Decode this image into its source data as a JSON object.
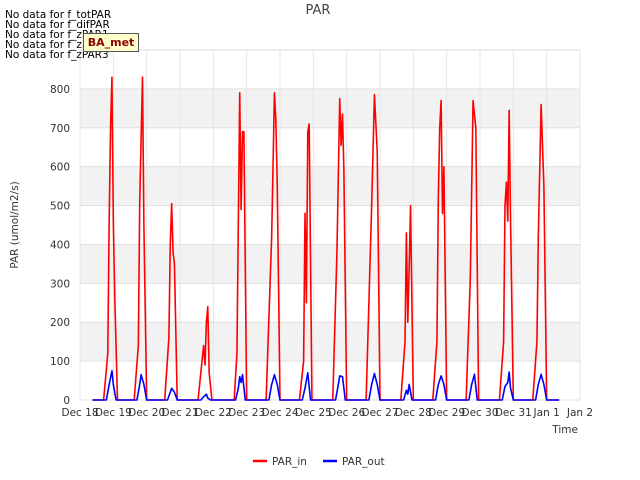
{
  "no_data_notes": [
    "No data for f_totPAR",
    "No data for f_difPAR",
    "No data for f_zPAR1",
    "No data for f_zPAR2",
    "No data for f_zPAR3"
  ],
  "badge": {
    "label": "BA_met",
    "bg": "#ffffcc",
    "text_color": "#8b0000"
  },
  "chart_data": {
    "type": "line",
    "title": "PAR",
    "xlabel": "Time",
    "ylabel": "PAR (umol/m2/s)",
    "ylim": [
      0,
      900
    ],
    "y_ticks": [
      0,
      100,
      200,
      300,
      400,
      500,
      600,
      700,
      800
    ],
    "x_range": [
      "2016-12-18",
      "2017-01-02"
    ],
    "x_tick_labels": [
      "Dec 18",
      "Dec 19",
      "Dec 20",
      "Dec 21",
      "Dec 22",
      "Dec 23",
      "Dec 24",
      "Dec 25",
      "Dec 26",
      "Dec 27",
      "Dec 28",
      "Dec 29",
      "Dec 30",
      "Dec 31",
      "Jan 1",
      "Jan 2"
    ],
    "x_tick_dates": [
      "2016-12-18",
      "2016-12-19",
      "2016-12-20",
      "2016-12-21",
      "2016-12-22",
      "2016-12-23",
      "2016-12-24",
      "2016-12-25",
      "2016-12-26",
      "2016-12-27",
      "2016-12-28",
      "2016-12-29",
      "2016-12-30",
      "2016-12-31",
      "2017-01-01",
      "2017-01-02"
    ],
    "grid": true,
    "legend_placement": "bottom-center",
    "series": [
      {
        "name": "PAR_in",
        "color": "#ff0000",
        "points": [
          [
            "2016-12-18 09:00",
            0
          ],
          [
            "2016-12-18 17:00",
            0
          ],
          [
            "2016-12-18 20:00",
            120
          ],
          [
            "2016-12-18 21:00",
            460
          ],
          [
            "2016-12-18 22:00",
            700
          ],
          [
            "2016-12-18 23:00",
            830
          ],
          [
            "2016-12-19 00:00",
            460
          ],
          [
            "2016-12-19 01:00",
            270
          ],
          [
            "2016-12-19 03:00",
            0
          ],
          [
            "2016-12-19 15:00",
            0
          ],
          [
            "2016-12-19 18:00",
            140
          ],
          [
            "2016-12-19 19:00",
            510
          ],
          [
            "2016-12-19 21:00",
            830
          ],
          [
            "2016-12-19 22:00",
            450
          ],
          [
            "2016-12-20 00:00",
            0
          ],
          [
            "2016-12-20 13:00",
            0
          ],
          [
            "2016-12-20 16:00",
            160
          ],
          [
            "2016-12-20 17:00",
            400
          ],
          [
            "2016-12-20 18:00",
            505
          ],
          [
            "2016-12-20 19:00",
            380
          ],
          [
            "2016-12-20 20:00",
            350
          ],
          [
            "2016-12-20 22:00",
            0
          ],
          [
            "2016-12-21 13:00",
            0
          ],
          [
            "2016-12-21 17:00",
            140
          ],
          [
            "2016-12-21 18:00",
            90
          ],
          [
            "2016-12-21 19:00",
            200
          ],
          [
            "2016-12-21 20:00",
            240
          ],
          [
            "2016-12-21 21:00",
            70
          ],
          [
            "2016-12-21 23:00",
            0
          ],
          [
            "2016-12-22 15:00",
            0
          ],
          [
            "2016-12-22 17:00",
            120
          ],
          [
            "2016-12-22 19:00",
            790
          ],
          [
            "2016-12-22 20:00",
            490
          ],
          [
            "2016-12-22 21:00",
            690
          ],
          [
            "2016-12-22 22:00",
            690
          ],
          [
            "2016-12-23 00:00",
            0
          ],
          [
            "2016-12-23 14:00",
            0
          ],
          [
            "2016-12-23 18:00",
            420
          ],
          [
            "2016-12-23 20:00",
            790
          ],
          [
            "2016-12-23 21:00",
            720
          ],
          [
            "2016-12-23 22:00",
            560
          ],
          [
            "2016-12-24 00:00",
            0
          ],
          [
            "2016-12-24 14:00",
            0
          ],
          [
            "2016-12-24 17:00",
            100
          ],
          [
            "2016-12-24 18:00",
            480
          ],
          [
            "2016-12-24 19:00",
            250
          ],
          [
            "2016-12-24 20:00",
            690
          ],
          [
            "2016-12-24 21:00",
            710
          ],
          [
            "2016-12-24 23:00",
            0
          ],
          [
            "2016-12-25 14:00",
            0
          ],
          [
            "2016-12-25 17:00",
            380
          ],
          [
            "2016-12-25 19:00",
            775
          ],
          [
            "2016-12-25 20:00",
            655
          ],
          [
            "2016-12-25 21:00",
            735
          ],
          [
            "2016-12-25 22:00",
            590
          ],
          [
            "2016-12-26 00:00",
            0
          ],
          [
            "2016-12-26 14:00",
            0
          ],
          [
            "2016-12-26 18:00",
            500
          ],
          [
            "2016-12-26 20:00",
            785
          ],
          [
            "2016-12-26 22:00",
            640
          ],
          [
            "2016-12-27 00:00",
            0
          ],
          [
            "2016-12-27 15:00",
            0
          ],
          [
            "2016-12-27 18:00",
            150
          ],
          [
            "2016-12-27 19:00",
            430
          ],
          [
            "2016-12-27 20:00",
            200
          ],
          [
            "2016-12-27 21:00",
            340
          ],
          [
            "2016-12-27 22:00",
            500
          ],
          [
            "2016-12-28 00:00",
            0
          ],
          [
            "2016-12-28 14:00",
            0
          ],
          [
            "2016-12-28 17:00",
            150
          ],
          [
            "2016-12-28 18:00",
            520
          ],
          [
            "2016-12-28 19:00",
            700
          ],
          [
            "2016-12-28 20:00",
            770
          ],
          [
            "2016-12-28 21:00",
            480
          ],
          [
            "2016-12-28 22:00",
            600
          ],
          [
            "2016-12-29 00:00",
            0
          ],
          [
            "2016-12-29 14:00",
            0
          ],
          [
            "2016-12-29 17:00",
            310
          ],
          [
            "2016-12-29 19:00",
            770
          ],
          [
            "2016-12-29 21:00",
            700
          ],
          [
            "2016-12-29 23:00",
            0
          ],
          [
            "2016-12-30 14:00",
            0
          ],
          [
            "2016-12-30 17:00",
            150
          ],
          [
            "2016-12-30 18:00",
            500
          ],
          [
            "2016-12-30 19:00",
            560
          ],
          [
            "2016-12-30 20:00",
            460
          ],
          [
            "2016-12-30 21:00",
            745
          ],
          [
            "2016-12-30 22:00",
            460
          ],
          [
            "2016-12-31 00:00",
            0
          ],
          [
            "2016-12-31 14:00",
            0
          ],
          [
            "2016-12-31 17:00",
            150
          ],
          [
            "2016-12-31 18:00",
            420
          ],
          [
            "2016-12-31 20:00",
            760
          ],
          [
            "2016-12-31 22:00",
            550
          ],
          [
            "2017-01-01 00:00",
            0
          ],
          [
            "2017-01-01 09:00",
            0
          ]
        ]
      },
      {
        "name": "PAR_out",
        "color": "#0000ff",
        "points": [
          [
            "2016-12-18 09:00",
            0
          ],
          [
            "2016-12-18 19:00",
            0
          ],
          [
            "2016-12-18 21:00",
            40
          ],
          [
            "2016-12-18 23:00",
            75
          ],
          [
            "2016-12-19 00:00",
            40
          ],
          [
            "2016-12-19 02:00",
            0
          ],
          [
            "2016-12-19 17:00",
            0
          ],
          [
            "2016-12-19 19:00",
            40
          ],
          [
            "2016-12-19 20:00",
            65
          ],
          [
            "2016-12-19 22:00",
            40
          ],
          [
            "2016-12-20 00:00",
            0
          ],
          [
            "2016-12-20 15:00",
            0
          ],
          [
            "2016-12-20 17:00",
            20
          ],
          [
            "2016-12-20 18:00",
            30
          ],
          [
            "2016-12-20 20:00",
            20
          ],
          [
            "2016-12-20 22:00",
            0
          ],
          [
            "2016-12-21 15:00",
            0
          ],
          [
            "2016-12-21 17:00",
            8
          ],
          [
            "2016-12-21 19:00",
            15
          ],
          [
            "2016-12-21 20:00",
            5
          ],
          [
            "2016-12-21 22:00",
            0
          ],
          [
            "2016-12-22 16:00",
            0
          ],
          [
            "2016-12-22 18:00",
            30
          ],
          [
            "2016-12-22 19:00",
            60
          ],
          [
            "2016-12-22 20:00",
            45
          ],
          [
            "2016-12-22 21:00",
            65
          ],
          [
            "2016-12-22 23:00",
            0
          ],
          [
            "2016-12-23 16:00",
            0
          ],
          [
            "2016-12-23 18:00",
            40
          ],
          [
            "2016-12-23 20:00",
            65
          ],
          [
            "2016-12-23 22:00",
            40
          ],
          [
            "2016-12-24 00:00",
            0
          ],
          [
            "2016-12-24 16:00",
            0
          ],
          [
            "2016-12-24 18:00",
            30
          ],
          [
            "2016-12-24 20:00",
            70
          ],
          [
            "2016-12-24 22:00",
            0
          ],
          [
            "2016-12-25 16:00",
            0
          ],
          [
            "2016-12-25 18:00",
            40
          ],
          [
            "2016-12-25 19:00",
            62
          ],
          [
            "2016-12-25 21:00",
            60
          ],
          [
            "2016-12-25 23:00",
            0
          ],
          [
            "2016-12-26 16:00",
            0
          ],
          [
            "2016-12-26 18:00",
            40
          ],
          [
            "2016-12-26 20:00",
            68
          ],
          [
            "2016-12-26 22:00",
            40
          ],
          [
            "2016-12-27 00:00",
            0
          ],
          [
            "2016-12-27 17:00",
            0
          ],
          [
            "2016-12-27 19:00",
            25
          ],
          [
            "2016-12-27 20:00",
            15
          ],
          [
            "2016-12-27 21:00",
            40
          ],
          [
            "2016-12-27 23:00",
            0
          ],
          [
            "2016-12-28 16:00",
            0
          ],
          [
            "2016-12-28 18:00",
            40
          ],
          [
            "2016-12-28 20:00",
            62
          ],
          [
            "2016-12-28 22:00",
            40
          ],
          [
            "2016-12-29 00:00",
            0
          ],
          [
            "2016-12-29 16:00",
            0
          ],
          [
            "2016-12-29 18:00",
            40
          ],
          [
            "2016-12-29 20:00",
            66
          ],
          [
            "2016-12-29 22:00",
            0
          ],
          [
            "2016-12-30 16:00",
            0
          ],
          [
            "2016-12-30 18:00",
            35
          ],
          [
            "2016-12-30 20:00",
            45
          ],
          [
            "2016-12-30 21:00",
            72
          ],
          [
            "2016-12-30 22:00",
            30
          ],
          [
            "2016-12-31 00:00",
            0
          ],
          [
            "2016-12-31 16:00",
            0
          ],
          [
            "2016-12-31 18:00",
            40
          ],
          [
            "2016-12-31 20:00",
            66
          ],
          [
            "2016-12-31 22:00",
            40
          ],
          [
            "2017-01-01 00:00",
            0
          ],
          [
            "2017-01-01 09:00",
            0
          ]
        ]
      }
    ]
  }
}
